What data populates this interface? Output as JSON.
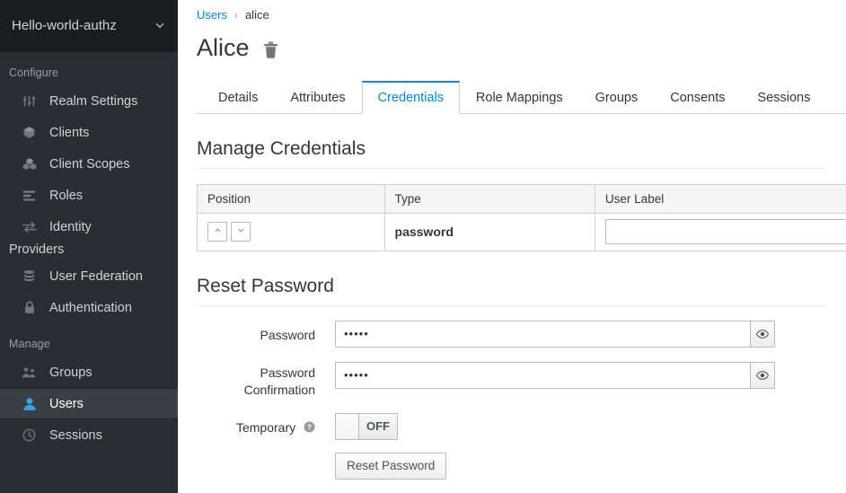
{
  "sidebar": {
    "realm": {
      "name": "Hello-world-authz",
      "caret_icon": "chevron-down-icon"
    },
    "groups": [
      {
        "title": "Configure",
        "items": [
          {
            "label": "Realm Settings",
            "icon": "sliders-icon",
            "selected": false
          },
          {
            "label": "Clients",
            "icon": "cube-icon",
            "selected": false
          },
          {
            "label": "Client Scopes",
            "icon": "cubes-icon",
            "selected": false
          },
          {
            "label": "Roles",
            "icon": "list-icon",
            "selected": false
          },
          {
            "label": "Identity",
            "label2": "Providers",
            "icon": "exchange-arrows-icon",
            "selected": false
          },
          {
            "label": "User Federation",
            "icon": "database-icon",
            "selected": false
          },
          {
            "label": "Authentication",
            "icon": "lock-icon",
            "selected": false
          }
        ]
      },
      {
        "title": "Manage",
        "items": [
          {
            "label": "Groups",
            "icon": "users-group-icon",
            "selected": false
          },
          {
            "label": "Users",
            "icon": "user-icon",
            "selected": true
          },
          {
            "label": "Sessions",
            "icon": "clock-icon",
            "selected": false
          }
        ]
      }
    ]
  },
  "breadcrumb": {
    "root": "Users",
    "separator": "›",
    "current": "alice"
  },
  "header": {
    "title": "Alice",
    "delete_icon": "trash-icon"
  },
  "tabs": [
    {
      "label": "Details",
      "active": false
    },
    {
      "label": "Attributes",
      "active": false
    },
    {
      "label": "Credentials",
      "active": true
    },
    {
      "label": "Role Mappings",
      "active": false
    },
    {
      "label": "Groups",
      "active": false
    },
    {
      "label": "Consents",
      "active": false
    },
    {
      "label": "Sessions",
      "active": false
    }
  ],
  "manage_credentials": {
    "heading": "Manage Credentials",
    "columns": [
      "Position",
      "Type",
      "User Label"
    ],
    "rows": [
      {
        "position_up_icon": "chevron-up-icon",
        "position_down_icon": "chevron-down-icon",
        "type": "password",
        "user_label_value": "",
        "user_label_placeholder": ""
      }
    ]
  },
  "reset_password": {
    "heading": "Reset Password",
    "password": {
      "label": "Password",
      "value": "•••••",
      "toggle_icon": "eye-icon"
    },
    "password_confirmation": {
      "label_line1": "Password",
      "label_line2": "Confirmation",
      "value": "•••••",
      "toggle_icon": "eye-icon"
    },
    "temporary": {
      "label": "Temporary",
      "help_icon": "question-circle-icon",
      "state": "OFF"
    },
    "submit_label": "Reset Password"
  },
  "colors": {
    "sidebar_bg": "#292e34",
    "sidebar_selected_bg": "#383f45",
    "realm_bg": "#1b1d21",
    "accent_blue": "#0088ce",
    "icon_blue": "#39a5dc",
    "border_gray": "#d1d1d1"
  }
}
